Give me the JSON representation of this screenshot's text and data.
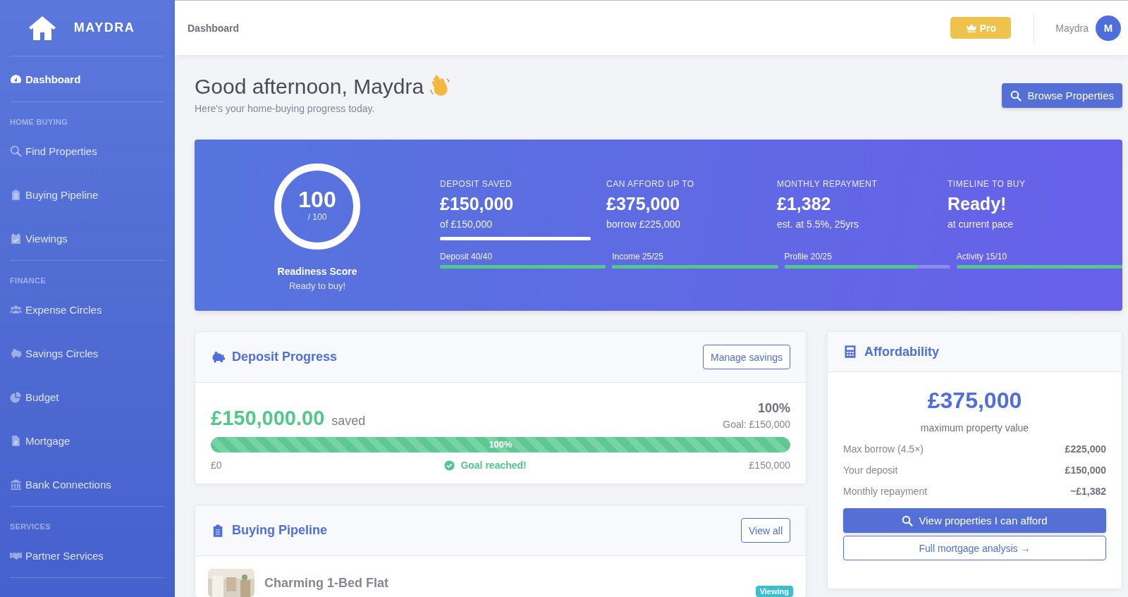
{
  "sidebar": {
    "brand": "MAYDRA",
    "sections": [
      {
        "items": [
          {
            "label": "Dashboard",
            "selected": true
          }
        ]
      },
      {
        "header": "HOME BUYING",
        "items": [
          {
            "label": "Find Properties",
            "selected": false
          },
          {
            "label": "Buying Pipeline",
            "selected": false
          },
          {
            "label": "Viewings",
            "selected": false
          }
        ]
      },
      {
        "header": "FINANCE",
        "items": [
          {
            "label": "Expense Circles",
            "selected": false
          },
          {
            "label": "Savings Circles",
            "selected": false
          },
          {
            "label": "Budget",
            "selected": false
          },
          {
            "label": "Mortgage",
            "selected": false
          },
          {
            "label": "Bank Connections",
            "selected": false
          }
        ]
      },
      {
        "header": "SERVICES",
        "items": [
          {
            "label": "Partner Services",
            "selected": false
          }
        ]
      }
    ]
  },
  "topbar": {
    "page_title": "Dashboard",
    "pro_button": "Pro",
    "user_name": "Maydra",
    "avatar": "M"
  },
  "greeting": {
    "title": "Good afternoon, Maydra",
    "subtitle": "Here's your home-buying progress today.",
    "action": "Browse Properties"
  },
  "readiness": {
    "score": "100",
    "out_of": "/ 100",
    "level": 1,
    "label": "Readiness Score",
    "status": "Ready to buy!",
    "stats": [
      {
        "label": "DEPOSIT SAVED",
        "value": "£150,000",
        "note": "of £150,000",
        "level": 1
      },
      {
        "label": "CAN AFFORD UP TO",
        "value": "£375,000",
        "note": "borrow £225,000"
      },
      {
        "label": "MONTHLY REPAYMENT",
        "value": "£1,382",
        "note": "est. at 5.5%, 25yrs"
      },
      {
        "label": "TIMELINE TO BUY",
        "value": "Ready!",
        "note": "at current pace"
      }
    ],
    "components": [
      {
        "label": "Deposit 40/40",
        "level": 1
      },
      {
        "label": "Income 25/25",
        "level": 1
      },
      {
        "label": "Profile 20/25",
        "level": 0.8
      },
      {
        "label": "Activity 15/10",
        "level": 1
      }
    ]
  },
  "deposit_progress": {
    "title": "Deposit Progress",
    "action": "Manage savings",
    "amount": "£150,000.00",
    "amount_suffix": "saved",
    "percent": "100%",
    "goal": "Goal: £150,000",
    "level": 1,
    "bar_label": "100%",
    "min": "£0",
    "status": "Goal reached!",
    "max": "£150,000"
  },
  "affordability": {
    "title": "Affordability",
    "value": "£375,000",
    "caption": "maximum property value",
    "rows": [
      {
        "label": "Max borrow (4.5×)",
        "value": "£225,000"
      },
      {
        "label": "Your deposit",
        "value": "£150,000"
      },
      {
        "label": "Monthly repayment",
        "value": "~£1,382"
      }
    ],
    "primary_button": "View properties I can afford",
    "secondary_button": "Full mortgage analysis →"
  },
  "buying_pipeline": {
    "title": "Buying Pipeline",
    "action": "View all",
    "items": [
      {
        "kind": "picture",
        "title": "Charming 1-Bed Flat",
        "status": "Viewing"
      }
    ]
  }
}
